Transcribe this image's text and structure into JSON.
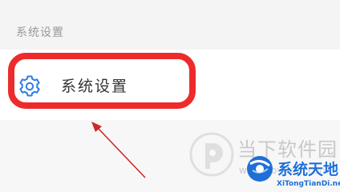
{
  "section": {
    "header": "系统设置"
  },
  "settings_row": {
    "icon": "gear-icon",
    "label": "系统设置"
  },
  "annotation": {
    "highlight_color": "#ee2b2b",
    "arrow_color": "#cc2a2a"
  },
  "watermarks": {
    "site1": {
      "text": "当下软件园",
      "url": "www.downxia.com"
    },
    "site2": {
      "text": "系统天地",
      "url": "XiTongTianDi.net",
      "color": "#1f6fd6"
    }
  },
  "colors": {
    "accent": "#2f7de1",
    "background": "#f7f7f7",
    "row_background": "#ffffff"
  }
}
